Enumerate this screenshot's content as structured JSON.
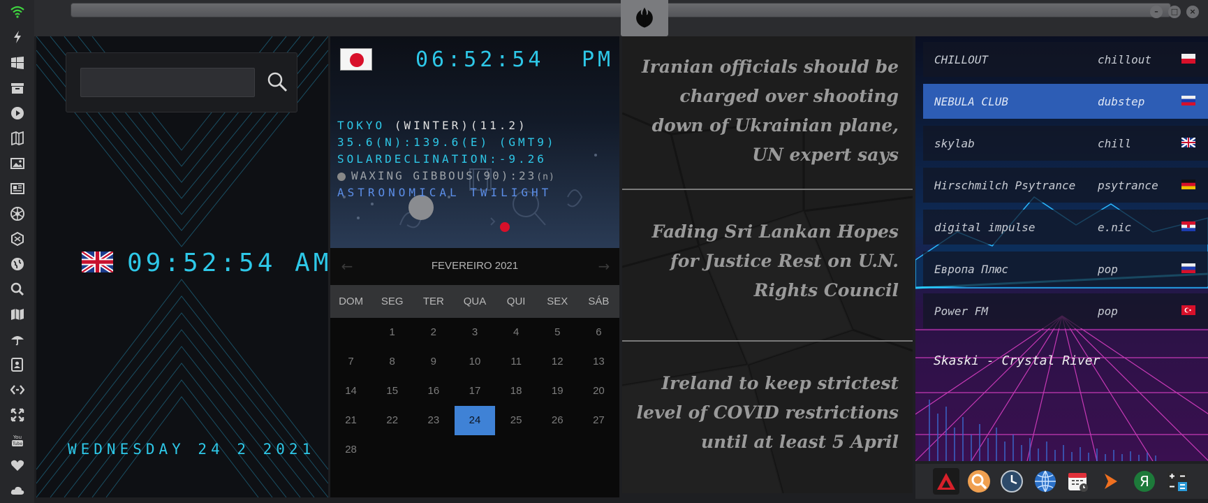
{
  "window": {
    "minimize_label": "–",
    "maximize_label": "□",
    "close_label": "×"
  },
  "sidebar": {
    "icons": [
      "wifi-icon",
      "lightning-icon",
      "windows-icon",
      "archive-icon",
      "play-icon",
      "map-book-icon",
      "image-icon",
      "news-icon",
      "rebel-icon",
      "shield-hex-icon",
      "globe-icon",
      "search-icon",
      "map-icon",
      "umbrella-icon",
      "contacts-icon",
      "code-icon",
      "expand-icon",
      "youtube-icon",
      "heart-icon",
      "cloud-icon"
    ]
  },
  "search": {
    "value": "",
    "placeholder": ""
  },
  "clock": {
    "time": "09:52:54 AM",
    "date": "WEDNESDAY 24 2 2021"
  },
  "world": {
    "time": "06:52:54",
    "ampm": "PM",
    "location": "TOKYO",
    "season": "(WINTER)(11.2)",
    "coords": "35.6(N):139.6(E) (GMT9)",
    "declination": "SOLARDECLINATION:-9.26",
    "moon": "WAXING GIBBOUS(90):23",
    "moon_suffix": "(n)",
    "twilight": "ASTRONOMICAL TWILIGHT"
  },
  "calendar": {
    "title": "FEVEREIRO 2021",
    "prev": "←",
    "next": "→",
    "weekdays": [
      "DOM",
      "SEG",
      "TER",
      "QUA",
      "QUI",
      "SEX",
      "SÁB"
    ],
    "leading_blanks": 1,
    "days": [
      "1",
      "2",
      "3",
      "4",
      "5",
      "6",
      "7",
      "8",
      "9",
      "10",
      "11",
      "12",
      "13",
      "14",
      "15",
      "16",
      "17",
      "18",
      "19",
      "20",
      "21",
      "22",
      "23",
      "24",
      "25",
      "26",
      "27",
      "28"
    ],
    "today": "24"
  },
  "news": {
    "items": [
      "Iranian officials should be charged over shooting down of Ukrainian plane, UN expert says",
      "Fading Sri Lankan Hopes for Justice Rest on U.N. Rights Council",
      "Ireland to keep strictest level of COVID restrictions until at least 5 April"
    ]
  },
  "radio": {
    "stations": [
      {
        "name": "CHILLOUT",
        "genre": "chillout",
        "flag": "poland"
      },
      {
        "name": "NEBULA CLUB",
        "genre": "dubstep",
        "flag": "russia"
      },
      {
        "name": "skylab",
        "genre": "chill",
        "flag": "uk"
      },
      {
        "name": "Hirschmilch Psytrance",
        "genre": "psytrance",
        "flag": "germany"
      },
      {
        "name": "digital impulse",
        "genre": "e.nic",
        "flag": "croatia"
      },
      {
        "name": "Европа Плюс",
        "genre": "pop",
        "flag": "russia"
      },
      {
        "name": "Power FM",
        "genre": "pop",
        "flag": "turkey"
      }
    ],
    "active_index": 1,
    "now_playing": "Skaski - Crystal River"
  },
  "dock": {
    "icons": [
      "red-triangle-app-icon",
      "magnifier-app-icon",
      "clock-app-icon",
      "globe-app-icon",
      "calendar-app-icon",
      "arrow-app-icon",
      "yandex-app-icon",
      "calculator-app-icon"
    ]
  },
  "colors": {
    "cyan": "#2ec8e8",
    "accent_blue": "#3f82d6",
    "radio_active": "#2d5db5"
  }
}
